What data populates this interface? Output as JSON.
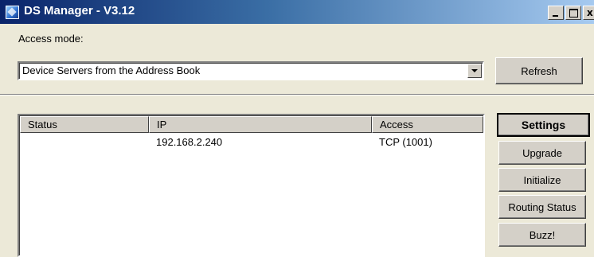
{
  "window": {
    "title": "DS Manager - V3.12",
    "caption_close": "x"
  },
  "access_mode": {
    "label": "Access mode:",
    "selected": "Device Servers from the Address Book"
  },
  "buttons": {
    "refresh": "Refresh",
    "settings": "Settings",
    "upgrade": "Upgrade",
    "initialize": "Initialize",
    "routing_status": "Routing Status",
    "buzz": "Buzz!"
  },
  "table": {
    "columns": [
      "Status",
      "IP",
      "Access"
    ],
    "rows": [
      {
        "status": "",
        "ip": "192.168.2.240",
        "access": "TCP (1001)"
      }
    ]
  }
}
